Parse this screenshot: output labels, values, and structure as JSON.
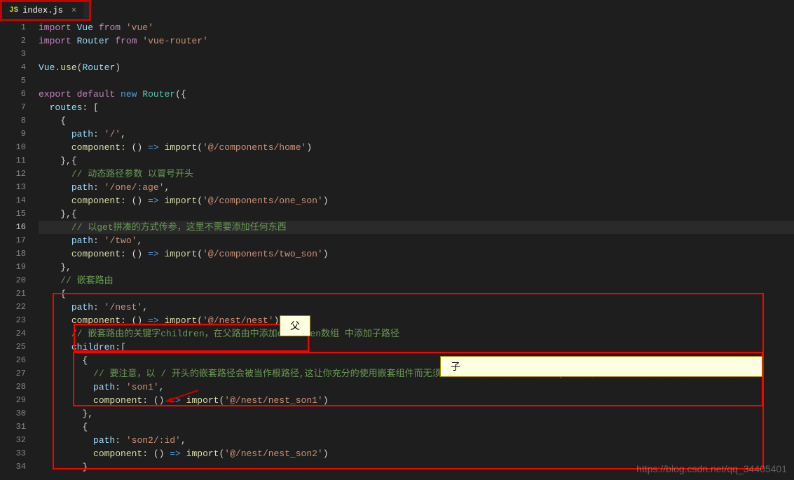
{
  "tab": {
    "icon": "JS",
    "name": "index.js"
  },
  "lines": [
    1,
    2,
    3,
    4,
    5,
    6,
    7,
    8,
    9,
    10,
    11,
    12,
    13,
    14,
    15,
    16,
    17,
    18,
    19,
    20,
    21,
    22,
    23,
    24,
    25,
    26,
    27,
    28,
    29,
    30,
    31,
    32,
    33,
    34
  ],
  "activeLine": 16,
  "code": {
    "l1_import": "import",
    "l1_vue": "Vue",
    "l1_from": "from",
    "l1_str": "'vue'",
    "l2_import": "import",
    "l2_router": "Router",
    "l2_from": "from",
    "l2_str": "'vue-router'",
    "l4_vue": "Vue",
    "l4_use": "use",
    "l4_router": "Router",
    "l6_export": "export",
    "l6_default": "default",
    "l6_new": "new",
    "l6_router": "Router",
    "l7_routes": "routes",
    "l9_path": "path",
    "l9_val": "'/'",
    "l10_comp": "component",
    "l10_imp": "import",
    "l10_str": "'@/components/home'",
    "l12_cm": "// 动态路径参数 以冒号开头",
    "l13_path": "path",
    "l13_val": "'/one/:age'",
    "l14_comp": "component",
    "l14_imp": "import",
    "l14_str": "'@/components/one_son'",
    "l16_cm": "// 以get拼凑的方式传参，这里不需要添加任何东西",
    "l17_path": "path",
    "l17_val": "'/two'",
    "l18_comp": "component",
    "l18_imp": "import",
    "l18_str": "'@/components/two_son'",
    "l20_cm": "// 嵌套路由",
    "l22_path": "path",
    "l22_val": "'/nest'",
    "l23_comp": "component",
    "l23_imp": "import",
    "l23_str": "'@/nest/nest'",
    "l24_cm": "// 嵌套路由的关键字children，在父路由中添加children数组 中添加子路径",
    "l25_children": "children",
    "l27_cm": "// 要注意，以 / 开头的嵌套路径会被当作根路径,这让你充分的使用嵌套组件而无须设置嵌套的路径。如果这里的path的值为'/son1将无法渲染son1子组件",
    "l28_path": "path",
    "l28_val": "'son1'",
    "l29_comp": "component",
    "l29_imp": "import",
    "l29_str": "'@/nest/nest_son1'",
    "l32_path": "path",
    "l32_val": "'son2/:id'",
    "l33_comp": "component",
    "l33_imp": "import",
    "l33_str": "'@/nest/nest_son2'"
  },
  "annot": {
    "parent": "父",
    "child": "子"
  },
  "watermark": "https://blog.csdn.net/qq_34405401"
}
